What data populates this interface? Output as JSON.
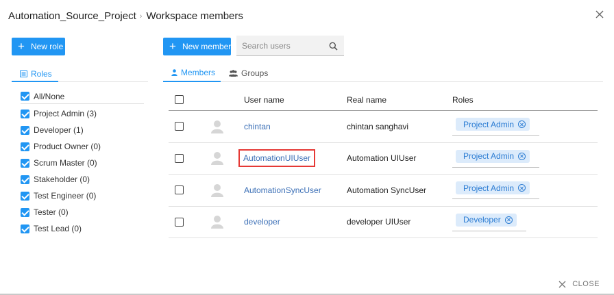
{
  "header": {
    "project": "Automation_Source_Project",
    "separator": "›",
    "title": "Workspace members"
  },
  "toolbar": {
    "new_role_label": "New role",
    "new_member_label": "New member",
    "search_placeholder": "Search users"
  },
  "roles_panel": {
    "tab_label": "Roles",
    "items": [
      {
        "label": "All/None",
        "checked": true
      },
      {
        "label": "Project Admin (3)",
        "checked": true
      },
      {
        "label": "Developer (1)",
        "checked": true
      },
      {
        "label": "Product Owner (0)",
        "checked": true
      },
      {
        "label": "Scrum Master (0)",
        "checked": true
      },
      {
        "label": "Stakeholder (0)",
        "checked": true
      },
      {
        "label": "Test Engineer (0)",
        "checked": true
      },
      {
        "label": "Tester (0)",
        "checked": true
      },
      {
        "label": "Test Lead (0)",
        "checked": true
      }
    ]
  },
  "tabs": {
    "members": "Members",
    "groups": "Groups"
  },
  "table": {
    "columns": {
      "user_name": "User name",
      "real_name": "Real name",
      "roles": "Roles"
    },
    "rows": [
      {
        "user": "chintan",
        "real": "chintan sanghavi",
        "role": "Project Admin"
      },
      {
        "user": "AutomationUIUser",
        "real": "Automation UIUser",
        "role": "Project Admin"
      },
      {
        "user": "AutomationSyncUser",
        "real": "Automation SyncUser",
        "role": "Project Admin"
      },
      {
        "user": "developer",
        "real": "developer UIUser",
        "role": "Developer"
      }
    ]
  },
  "footer": {
    "close_label": "CLOSE"
  },
  "colors": {
    "accent": "#2196f3",
    "link": "#3b6fb6",
    "chip_bg": "#dcebfb",
    "highlight": "#e53935"
  }
}
